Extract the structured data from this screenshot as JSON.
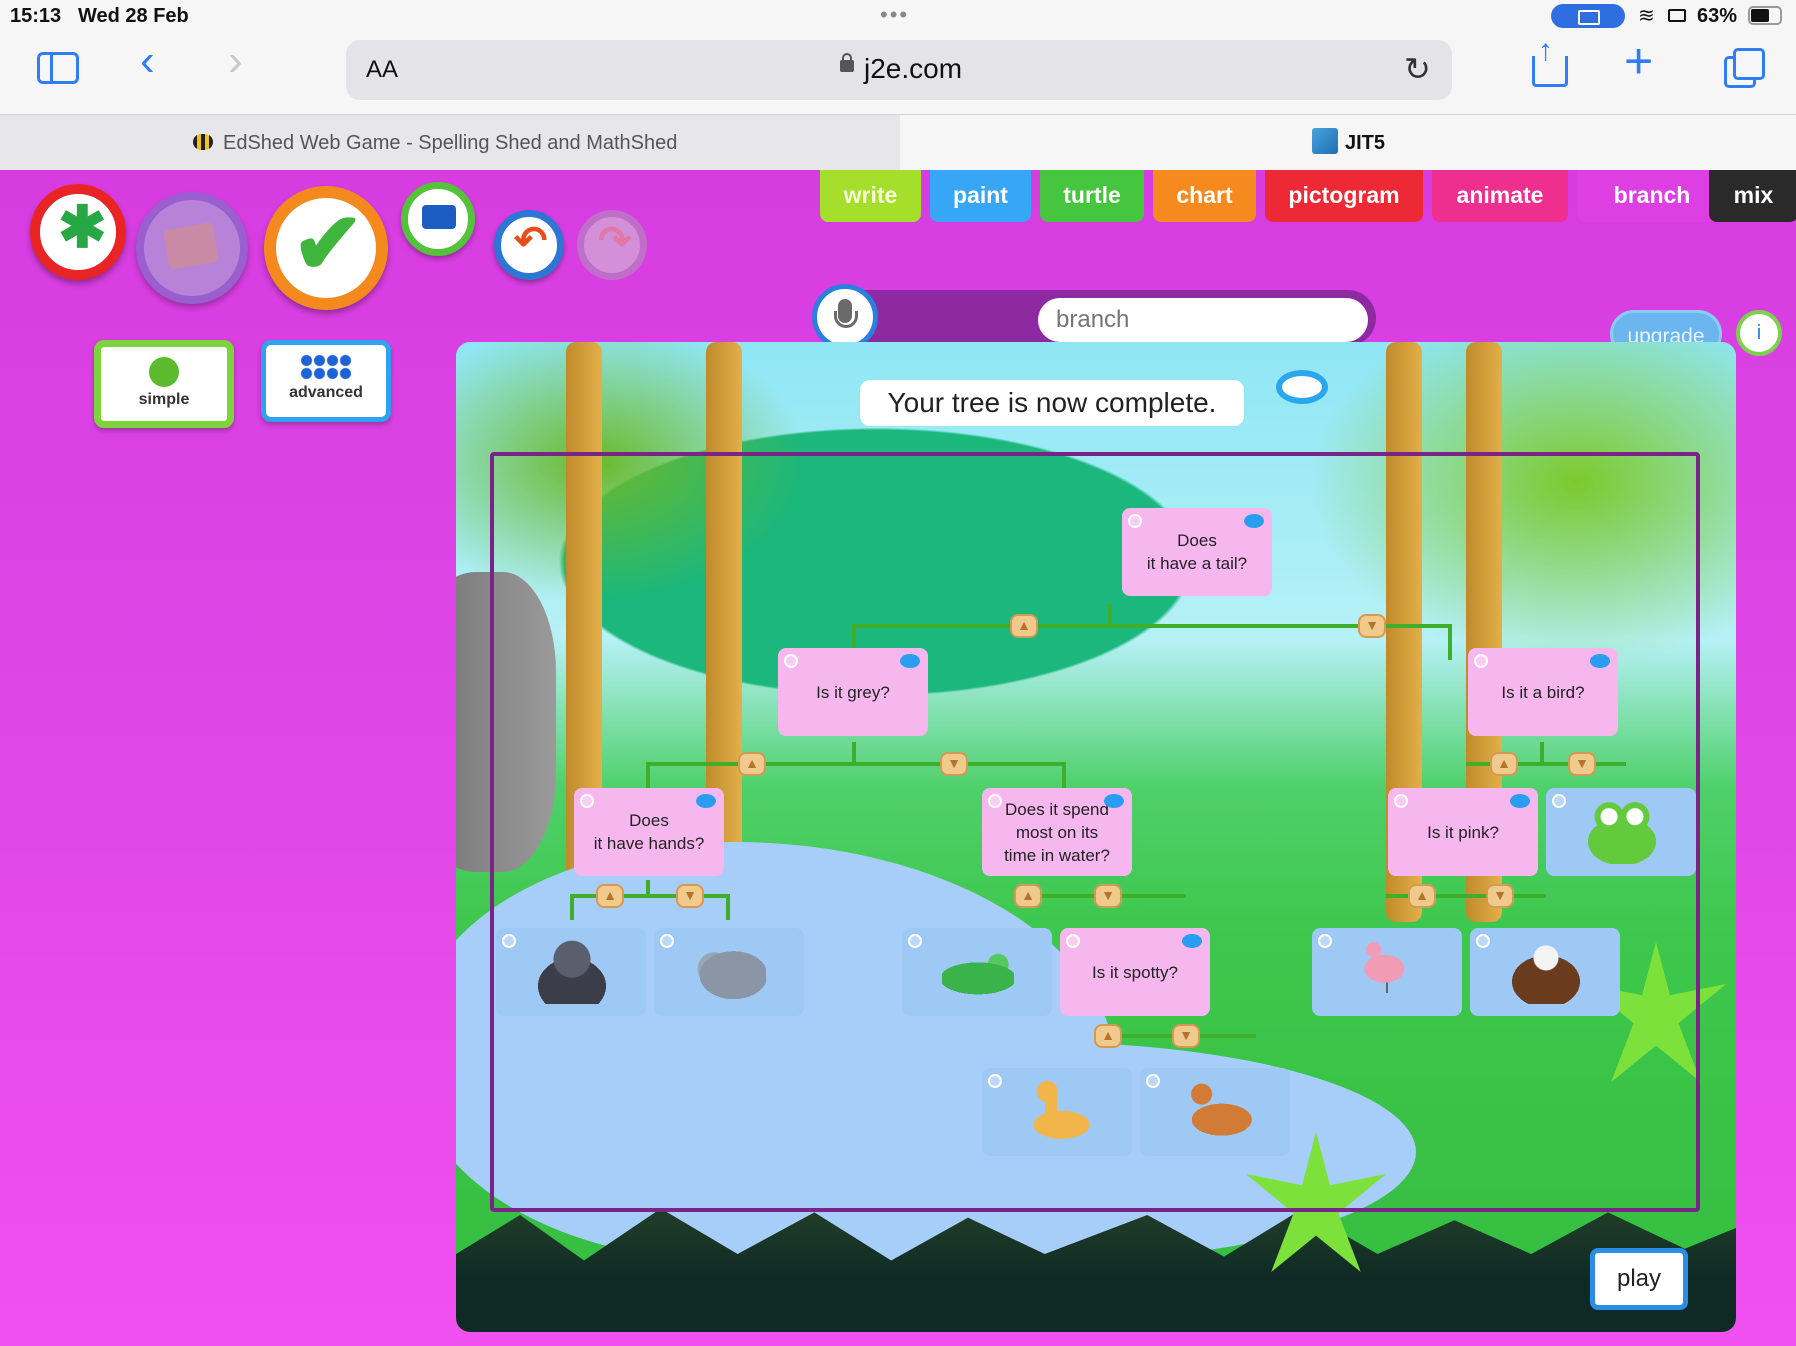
{
  "status_bar": {
    "time": "15:13",
    "date": "Wed 28 Feb",
    "dots": "•••",
    "battery": "63%"
  },
  "browser": {
    "text_size_label": "AA",
    "url": "j2e.com",
    "tabs": [
      {
        "title": "EdShed Web Game - Spelling Shed and MathShed",
        "close": "×"
      },
      {
        "title": "JIT5"
      }
    ]
  },
  "app": {
    "tools": [
      "write",
      "paint",
      "turtle",
      "chart",
      "pictogram",
      "animate",
      "branch",
      "mix"
    ],
    "modes": {
      "simple": "simple",
      "advanced": "advanced"
    },
    "title_input": {
      "placeholder": "branch"
    },
    "upgrade": "upgrade",
    "info": "i",
    "message": "Your tree is now complete.",
    "play": "play"
  },
  "tree": {
    "root": "Does\nit have a tail?",
    "q_left": "Is it grey?",
    "q_right": "Is it a bird?",
    "q_hands": "Does\nit have hands?",
    "q_water": "Does it spend\nmost on its\ntime in water?",
    "q_pink": "Is it pink?",
    "q_spotty": "Is it spotty?",
    "answers": [
      "gorilla",
      "elephant",
      "crocodile",
      "flamingo",
      "eagle",
      "frog",
      "giraffe",
      "horse"
    ]
  },
  "colors": {
    "app_background": "#e047e6",
    "tree_frame": "#7b2487",
    "question_node": "#f6b7ef",
    "answer_node": "#9ec9f4"
  }
}
